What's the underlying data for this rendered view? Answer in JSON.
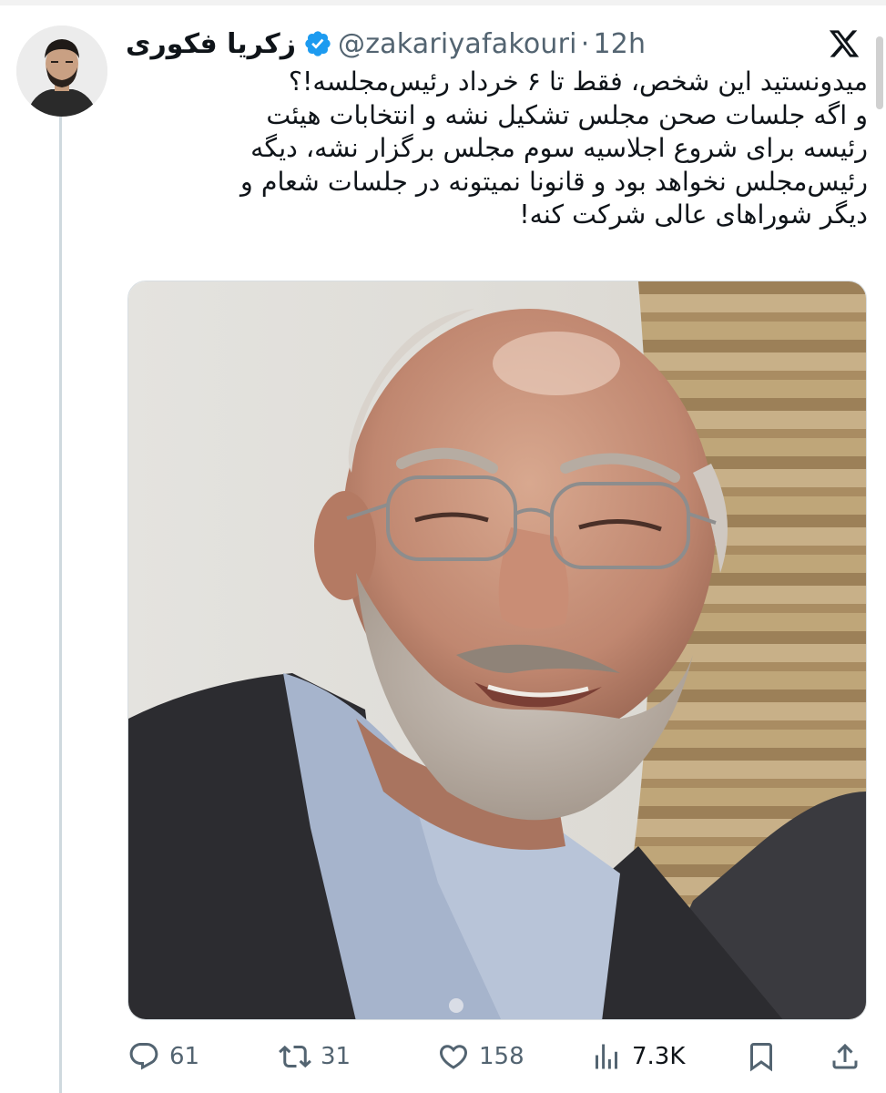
{
  "author": {
    "display_name": "زکریا فکوری",
    "handle": "@zakariyafakouri",
    "separator": "·",
    "time": "12h",
    "verified_color": "#1d9bf0"
  },
  "tweet": {
    "lines": [
      "میدونستید این شخص، فقط تا ۶ خرداد رئیس‌مجلسه!؟",
      "و اگه جلسات صحن مجلس تشکیل نشه و انتخابات هیئت",
      "رئیسه برای شروع اجلاسیه سوم مجلس برگزار نشه، دیگه",
      "رئیس‌مجلس نخواهد بود و قانونا نمیتونه در جلسات شعام و",
      "دیگر شوراهای عالی شرکت کنه!"
    ]
  },
  "actions": {
    "replies": "61",
    "reposts": "31",
    "likes": "158",
    "views": "7.3K"
  },
  "icons": {
    "platform": "x-logo-icon",
    "verified": "verified-badge-icon",
    "reply": "reply-icon",
    "repost": "repost-icon",
    "like": "heart-icon",
    "views": "views-chart-icon",
    "bookmark": "bookmark-icon",
    "share": "share-icon"
  },
  "colors": {
    "text": "#0f1419",
    "muted": "#536471",
    "accent": "#1d9bf0"
  }
}
